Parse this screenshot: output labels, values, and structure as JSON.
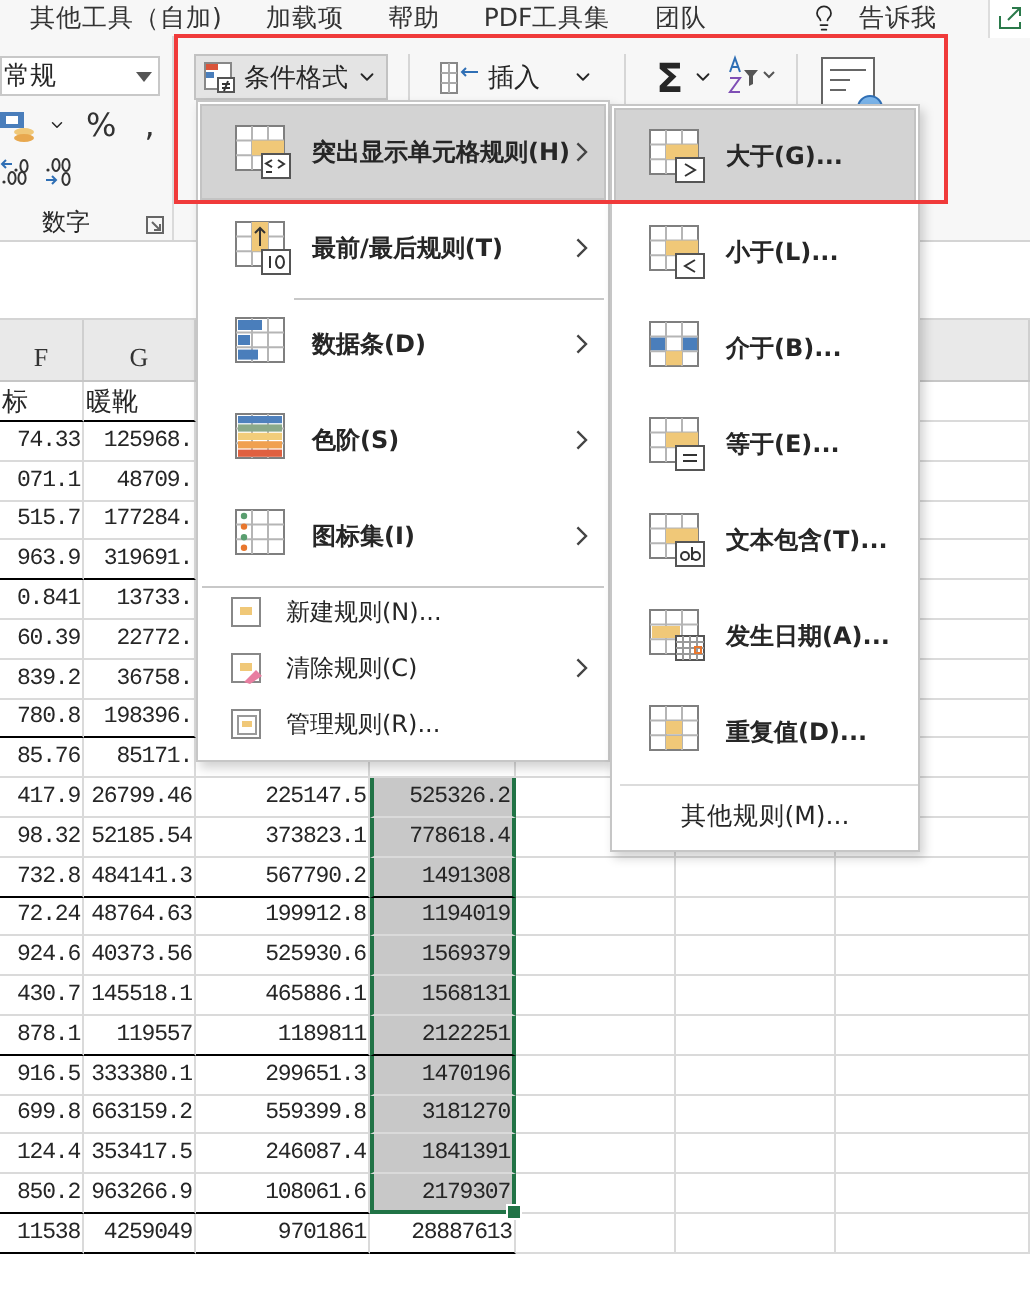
{
  "ribbon_tabs": [
    "其他工具（自加)",
    "加载项",
    "帮助",
    "PDF工具集",
    "团队"
  ],
  "tell_me": "告诉我",
  "number_group": {
    "format": "常规",
    "percent": "%",
    "comma": ",",
    "label": "数字"
  },
  "cells_group": {
    "conditional_formatting": {
      "label": "条件格式",
      "open": true
    },
    "insert": "插入",
    "autosum": "Σ"
  },
  "cf_menu": [
    {
      "kind": "large",
      "label": "突出显示单元格规则(H)",
      "selected": true,
      "submenu": true,
      "separator_before": false
    },
    {
      "kind": "large",
      "label": "最前/最后规则(T)",
      "selected": false,
      "submenu": true,
      "separator_before": false
    },
    {
      "kind": "large",
      "label": "数据条(D)",
      "selected": false,
      "submenu": true,
      "separator_before": true
    },
    {
      "kind": "large",
      "label": "色阶(S)",
      "selected": false,
      "submenu": true,
      "separator_before": false
    },
    {
      "kind": "large",
      "label": "图标集(I)",
      "selected": false,
      "submenu": true,
      "separator_before": false
    },
    {
      "kind": "small",
      "label": "新建规则(N)...",
      "selected": false,
      "submenu": false,
      "separator_before": true
    },
    {
      "kind": "small",
      "label": "清除规则(C)",
      "selected": false,
      "submenu": true,
      "separator_before": false
    },
    {
      "kind": "small",
      "label": "管理规则(R)...",
      "selected": false,
      "submenu": false,
      "separator_before": false
    }
  ],
  "highlight_rules_menu": {
    "items": [
      {
        "label": "大于(G)...",
        "selected": true
      },
      {
        "label": "小于(L)...",
        "selected": false
      },
      {
        "label": "介于(B)...",
        "selected": false
      },
      {
        "label": "等于(E)...",
        "selected": false
      },
      {
        "label": "文本包含(T)...",
        "selected": false
      },
      {
        "label": "发生日期(A)...",
        "selected": false
      },
      {
        "label": "重复值(D)...",
        "selected": false
      }
    ],
    "more": "其他规则(M)..."
  },
  "sheet": {
    "columns": [
      "F",
      "G"
    ],
    "rows": [
      {
        "cells": [
          "标",
          "暖靴"
        ],
        "group_end": true
      },
      {
        "cells": [
          "74.33",
          "125968."
        ],
        "group_end": false
      },
      {
        "cells": [
          "071.1",
          "48709."
        ],
        "group_end": false
      },
      {
        "cells": [
          "515.7",
          "177284."
        ],
        "group_end": false
      },
      {
        "cells": [
          "963.9",
          "319691."
        ],
        "group_end": true
      },
      {
        "cells": [
          "0.841",
          "13733."
        ],
        "group_end": false
      },
      {
        "cells": [
          "60.39",
          "22772."
        ],
        "group_end": false
      },
      {
        "cells": [
          "839.2",
          "36758."
        ],
        "group_end": false
      },
      {
        "cells": [
          "780.8",
          "198396."
        ],
        "group_end": true
      },
      {
        "cells": [
          "85.76",
          "85171."
        ],
        "group_end": false
      },
      {
        "cells": [
          "417.9",
          "26799.46",
          "225147.5",
          "525326.2"
        ],
        "selected": true,
        "group_end": false
      },
      {
        "cells": [
          "98.32",
          "52185.54",
          "373823.1",
          "778618.4"
        ],
        "selected": true,
        "group_end": false
      },
      {
        "cells": [
          "732.8",
          "484141.3",
          "567790.2",
          "1491308"
        ],
        "selected": true,
        "group_end": true
      },
      {
        "cells": [
          "72.24",
          "48764.63",
          "199912.8",
          "1194019"
        ],
        "selected": true,
        "group_end": false
      },
      {
        "cells": [
          "924.6",
          "40373.56",
          "525930.6",
          "1569379"
        ],
        "selected": true,
        "group_end": false
      },
      {
        "cells": [
          "430.7",
          "145518.1",
          "465886.1",
          "1568131"
        ],
        "selected": true,
        "group_end": false
      },
      {
        "cells": [
          "878.1",
          "119557",
          "1189811",
          "2122251"
        ],
        "selected": true,
        "group_end": true
      },
      {
        "cells": [
          "916.5",
          "333380.1",
          "299651.3",
          "1470196"
        ],
        "selected": true,
        "group_end": false
      },
      {
        "cells": [
          "699.8",
          "663159.2",
          "559399.8",
          "3181270"
        ],
        "selected": true,
        "group_end": false
      },
      {
        "cells": [
          "124.4",
          "353417.5",
          "246087.4",
          "1841391"
        ],
        "selected": true,
        "group_end": false
      },
      {
        "cells": [
          "850.2",
          "963266.9",
          "108061.6",
          "2179307"
        ],
        "selected": true,
        "group_end": true
      },
      {
        "cells": [
          "11538",
          "4259049",
          "9701861",
          "28887613"
        ],
        "selected": false,
        "group_end": true
      }
    ]
  }
}
